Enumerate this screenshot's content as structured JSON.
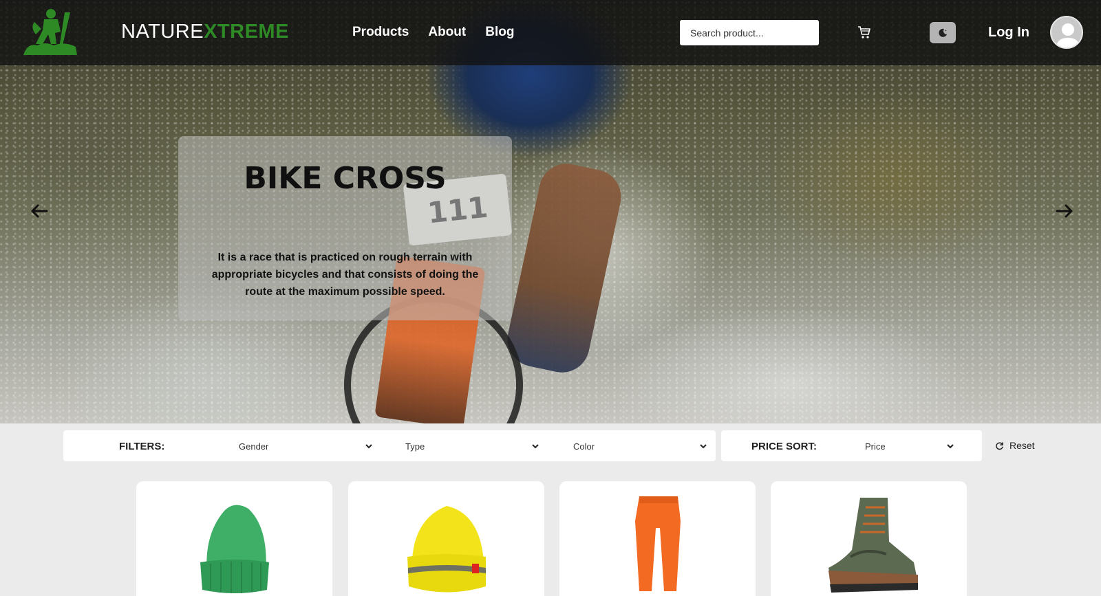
{
  "brand": {
    "part1": "NATURE",
    "part2": "XTREME"
  },
  "nav": {
    "links": [
      "Products",
      "About",
      "Blog"
    ]
  },
  "search": {
    "placeholder": "Search product..."
  },
  "auth": {
    "login_label": "Log In"
  },
  "hero": {
    "title": "BIKE CROSS",
    "description": "It is a race that is practiced on rough terrain with appropriate bicycles and that consists of doing the route at the maximum possible speed.",
    "bib_number": "111"
  },
  "filters": {
    "label": "FILTERS:",
    "gender": "Gender",
    "type": "Type",
    "color": "Color",
    "sort_label": "PRICE SORT:",
    "price": "Price",
    "reset": "Reset"
  },
  "products": [
    {
      "image": "green-beanie",
      "color": "#3fae67"
    },
    {
      "image": "yellow-beanie",
      "color": "#f2e31a"
    },
    {
      "image": "orange-pants",
      "color": "#f36a22"
    },
    {
      "image": "hiking-boot",
      "color": "#5d6a52"
    }
  ],
  "colors": {
    "accent": "#2e8a25",
    "navbar": "#121212",
    "page_bg": "#ebebeb"
  }
}
